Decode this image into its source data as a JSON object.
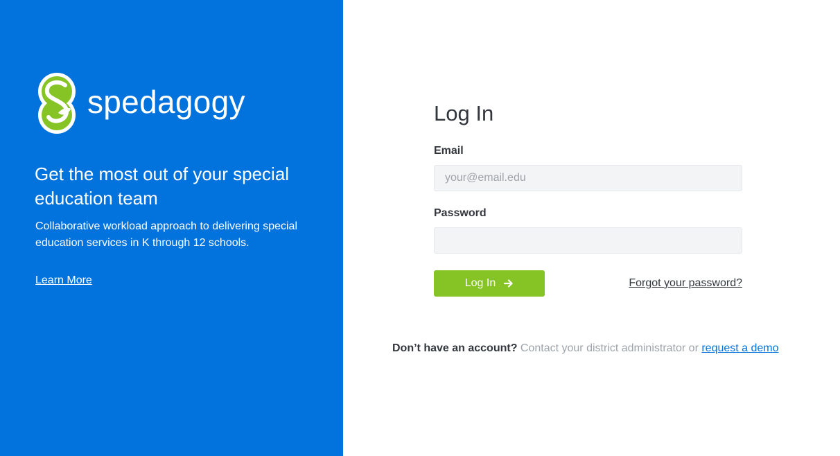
{
  "brand": {
    "name": "spedagogy",
    "headline": "Get the most out of your special education team",
    "subtext": "Collaborative workload approach to delivering special education services in K through 12 schools.",
    "learn_more": "Learn More",
    "colors": {
      "panel": "#0273dd",
      "logo_green": "#86c426"
    },
    "logo_icon": "spedagogy-logo-icon"
  },
  "form": {
    "title": "Log In",
    "email_label": "Email",
    "email_placeholder": "your@email.edu",
    "email_value": "",
    "password_label": "Password",
    "password_value": "",
    "submit_label": "Log In",
    "submit_icon": "arrow-right-icon",
    "forgot_password": "Forgot your password?",
    "colors": {
      "button": "#86c426",
      "link": "#0273dd"
    }
  },
  "signup": {
    "prompt": "Don’t have an account?",
    "text": " Contact your district administrator or ",
    "demo_link": "request a demo"
  }
}
